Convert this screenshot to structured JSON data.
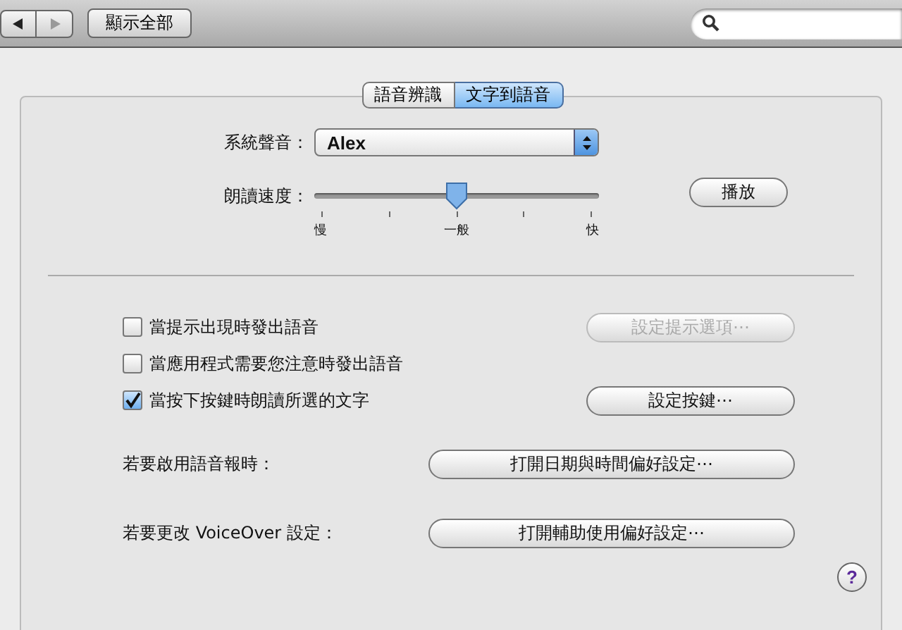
{
  "toolbar": {
    "show_all": "顯示全部"
  },
  "tabs": [
    {
      "label": "語音辨識",
      "selected": false
    },
    {
      "label": "文字到語音",
      "selected": true
    }
  ],
  "voice": {
    "label": "系統聲音：",
    "value": "Alex"
  },
  "rate": {
    "label": "朗讀速度：",
    "level": 0.5,
    "tick_labels": [
      "慢",
      "一般",
      "快"
    ],
    "button": "播放"
  },
  "options": [
    {
      "label": "當提示出現時發出語音",
      "checked": false,
      "button": {
        "label": "設定提示選項⋯",
        "disabled": true
      }
    },
    {
      "label": "當應用程式需要您注意時發出語音",
      "checked": false
    },
    {
      "label": "當按下按鍵時朗讀所選的文字",
      "checked": true,
      "button": {
        "label": "設定按鍵⋯",
        "disabled": false
      }
    }
  ],
  "actions": [
    {
      "label": "若要啟用語音報時：",
      "button": "打開日期與時間偏好設定⋯"
    },
    {
      "label": "若要更改 VoiceOver 設定：",
      "button": "打開輔助使用偏好設定⋯"
    }
  ],
  "help": "?"
}
